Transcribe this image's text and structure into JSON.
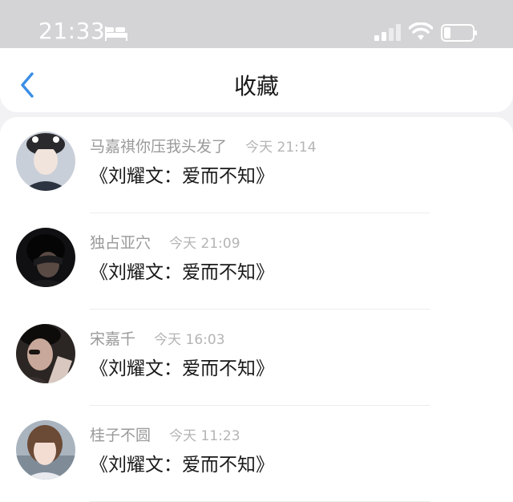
{
  "status_bar": {
    "time": "21:33",
    "icons": [
      "bed-icon",
      "cellular-signal-icon",
      "wifi-icon",
      "battery-icon"
    ]
  },
  "nav": {
    "back_icon": "chevron-left-icon",
    "title": "收藏"
  },
  "colors": {
    "accent": "#3a8ee6",
    "status_bar_bg": "#d4d4d6",
    "page_bg": "#f2f2f4"
  },
  "favorites": [
    {
      "user": "马嘉祺你压我头发了",
      "time": "今天 21:14",
      "content": "《刘耀文：爱而不知》"
    },
    {
      "user": "独占亚穴",
      "time": "今天 21:09",
      "content": "《刘耀文：爱而不知》"
    },
    {
      "user": "宋嘉千",
      "time": "今天 16:03",
      "content": "《刘耀文：爱而不知》"
    },
    {
      "user": "桂子不圆",
      "time": "今天 11:23",
      "content": "《刘耀文：爱而不知》"
    }
  ]
}
